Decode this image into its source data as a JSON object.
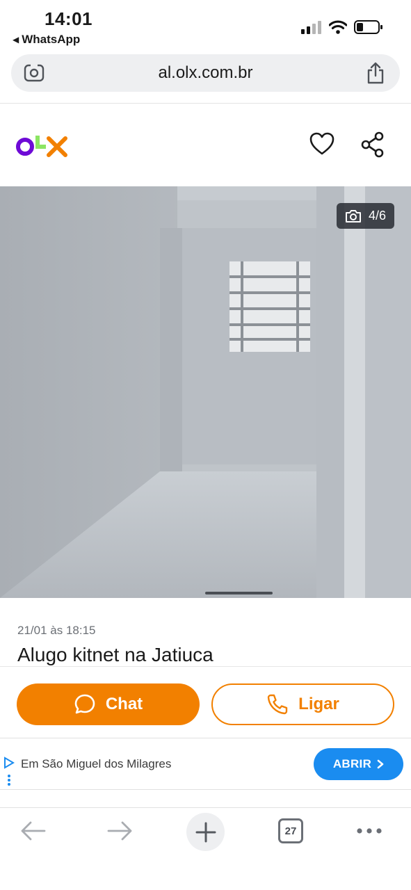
{
  "status": {
    "time": "14:01",
    "back_app": "WhatsApp"
  },
  "browser": {
    "url": "al.olx.com.br"
  },
  "header": {
    "logo": "OLX",
    "icons": [
      "heart-icon",
      "share-icon"
    ]
  },
  "photo": {
    "counter": "4/6"
  },
  "ad": {
    "date": "21/01 às 18:15",
    "title": "Alugo kitnet na Jatiuca"
  },
  "actions": {
    "chat_label": "Chat",
    "call_label": "Ligar"
  },
  "ad_banner": {
    "text": "Em São Miguel dos Milagres",
    "button_label": "ABRIR"
  },
  "toolbar": {
    "tab_count": "27"
  },
  "colors": {
    "accent": "#f28000",
    "logo_purple": "#6e0ad6",
    "logo_green": "#8ce563",
    "ad_blue": "#1a8cf0"
  }
}
